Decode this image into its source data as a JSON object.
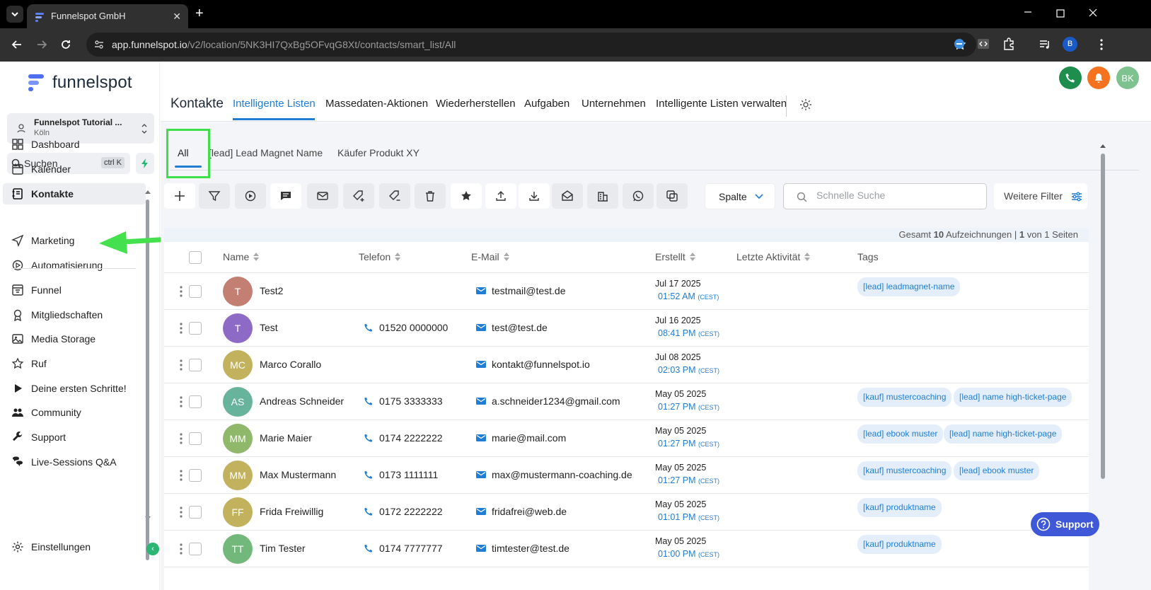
{
  "browser": {
    "tab_title": "Funnelspot GmbH",
    "url_host": "app.funnelspot.io",
    "url_path": "/v2/location/5NK3HI7QxBg5OFvqG8Xt/contacts/smart_list/All",
    "profile_initial": "B"
  },
  "sidebar": {
    "logo_text": "funnelspot",
    "location_name": "Funnelspot Tutorial ...",
    "location_city": "Köln",
    "search_label": "Suchen",
    "search_shortcut": "ctrl K",
    "items": [
      {
        "label": "Dashboard",
        "icon": "dashboard-icon"
      },
      {
        "label": "Kalender",
        "icon": "calendar-icon"
      },
      {
        "label": "Kontakte",
        "icon": "contacts-icon",
        "active": true
      },
      {
        "label": "Marketing",
        "icon": "send-icon"
      },
      {
        "label": "Automatisierung",
        "icon": "automation-icon"
      },
      {
        "label": "Funnel",
        "icon": "funnel-icon"
      },
      {
        "label": "Mitgliedschaften",
        "icon": "award-icon"
      },
      {
        "label": "Media Storage",
        "icon": "image-icon"
      },
      {
        "label": "Ruf",
        "icon": "star-icon"
      },
      {
        "label": "Deine ersten Schritte!",
        "icon": "play-icon"
      },
      {
        "label": "Community",
        "icon": "users-icon"
      },
      {
        "label": "Support",
        "icon": "wrench-icon"
      },
      {
        "label": "Live-Sessions Q&A",
        "icon": "chat-icon"
      }
    ],
    "settings_label": "Einstellungen"
  },
  "header": {
    "title": "Kontakte",
    "tabs": [
      "Intelligente Listen",
      "Massedaten-Aktionen",
      "Wiederherstellen",
      "Aufgaben",
      "Unternehmen",
      "Intelligente Listen verwalten"
    ],
    "avatar_initials": "BK",
    "colors": {
      "phone": "#1e8e4e",
      "bell": "#f5731e",
      "avatar": "#7ec28f",
      "accent": "#1f7dd6"
    }
  },
  "smartlists": {
    "tabs": [
      "All",
      "[lead] Lead Magnet Name",
      "Käufer Produkt XY"
    ]
  },
  "toolbar": {
    "column_button": "Spalte",
    "quick_search_placeholder": "Schnelle Suche",
    "more_filters": "Weitere Filter"
  },
  "table": {
    "summary_prefix": "Gesamt",
    "summary_count": "10",
    "summary_mid": "Aufzeichnungen |",
    "summary_page": "1",
    "summary_suffix": "von 1 Seiten",
    "columns": [
      "Name",
      "Telefon",
      "E-Mail",
      "Erstellt",
      "Letzte Aktivität",
      "Tags"
    ],
    "rows": [
      {
        "initials": "T",
        "color": "#c47f73",
        "name": "Test2",
        "phone": "",
        "email": "testmail@test.de",
        "date": "Jul 17 2025",
        "time": "01:52 AM",
        "tz": "(CEST)",
        "tags": [
          "[lead] leadmagnet-name"
        ]
      },
      {
        "initials": "T",
        "color": "#8e6ac7",
        "name": "Test",
        "phone": "01520 0000000",
        "email": "test@test.de",
        "date": "Jul 16 2025",
        "time": "08:41 PM",
        "tz": "(CEST)",
        "tags": []
      },
      {
        "initials": "MC",
        "color": "#c2b25e",
        "name": "Marco Corallo",
        "phone": "",
        "email": "kontakt@funnelspot.io",
        "date": "Jul 08 2025",
        "time": "02:03 PM",
        "tz": "(CEST)",
        "tags": []
      },
      {
        "initials": "AS",
        "color": "#68b39b",
        "name": "Andreas Schneider",
        "phone": "0175 3333333",
        "email": "a.schneider1234@gmail.com",
        "date": "May 05 2025",
        "time": "01:27 PM",
        "tz": "(CEST)",
        "tags": [
          "[kauf] mustercoaching",
          "[lead] name high-ticket-page"
        ]
      },
      {
        "initials": "MM",
        "color": "#8fb86a",
        "name": "Marie Maier",
        "phone": "0174 2222222",
        "email": "marie@mail.com",
        "date": "May 05 2025",
        "time": "01:27 PM",
        "tz": "(CEST)",
        "tags": [
          "[lead] ebook muster",
          "[lead] name high-ticket-page"
        ]
      },
      {
        "initials": "MM",
        "color": "#c2b25e",
        "name": "Max Mustermann",
        "phone": "0173 1111111",
        "email": "max@mustermann-coaching.de",
        "date": "May 05 2025",
        "time": "01:27 PM",
        "tz": "(CEST)",
        "tags": [
          "[kauf] mustercoaching",
          "[lead] ebook muster"
        ]
      },
      {
        "initials": "FF",
        "color": "#c2b25e",
        "name": "Frida Freiwillig",
        "phone": "0172 2222222",
        "email": "fridafrei@web.de",
        "date": "May 05 2025",
        "time": "01:01 PM",
        "tz": "(CEST)",
        "tags": [
          "[kauf] produktname"
        ]
      },
      {
        "initials": "TT",
        "color": "#72b87a",
        "name": "Tim Tester",
        "phone": "0174 7777777",
        "email": "timtester@test.de",
        "date": "May 05 2025",
        "time": "01:00 PM",
        "tz": "(CEST)",
        "tags": [
          "[kauf] produktname"
        ]
      }
    ]
  },
  "support_button": "Support"
}
